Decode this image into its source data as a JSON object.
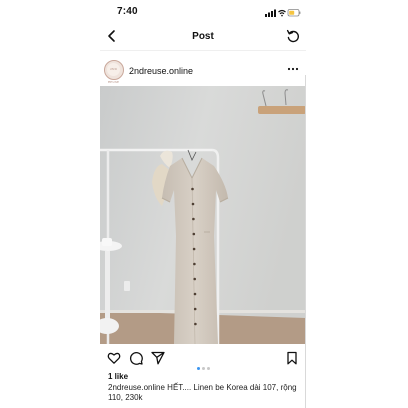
{
  "status_bar": {
    "time": "7:40",
    "icons": [
      "signal-icon",
      "wifi-icon",
      "battery-icon"
    ],
    "battery_color": "#f5c542"
  },
  "nav": {
    "title": "Post",
    "back_icon": "chevron-left-icon",
    "refresh_icon": "refresh-icon"
  },
  "post": {
    "username": "2ndreuse.online",
    "avatar_text": "2ND REUSE",
    "more_icon": "more-horizontal-icon",
    "photo_description_icons": [
      "hanger-rack",
      "dress",
      "wall-hooks"
    ],
    "actions": [
      "heart-icon",
      "comment-icon",
      "send-icon",
      "bookmark-icon"
    ],
    "carousel": {
      "count": 3,
      "active_index": 0,
      "active_color": "#3b95f0"
    },
    "likes": "1 like",
    "caption_user": "2ndreuse.online",
    "caption_text": "HẾT.... Linen be Korea dài 107, rộng 110, 230k"
  }
}
